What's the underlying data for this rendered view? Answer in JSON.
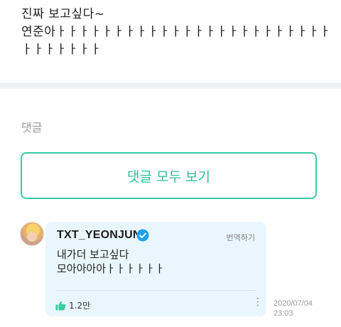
{
  "post": {
    "text": "진짜 보고싶다~\n연준아ㅏㅏㅏㅏㅏㅏㅏㅏㅏㅏㅏㅏㅏㅏㅏㅏㅏㅏㅏㅏㅏㅏㅏㅏㅏㅏㅏㅏㅏㅏㅏ"
  },
  "comments": {
    "section_label": "댓글",
    "view_all_label": "댓글 모두 보기"
  },
  "reply": {
    "author": "TXT_YEONJUN",
    "verified_icon": "verified-badge-icon",
    "translate_label": "번역하기",
    "text": "내가더 보고싶다\n모아아아아ㅏㅏㅏㅏㅏㅏ",
    "likes": "1.2만",
    "date": "2020/07/04",
    "time": "23:03",
    "more_icon": "more-vertical-icon"
  },
  "colors": {
    "accent": "#3bcba3",
    "bubble_bg": "#e9f6fd",
    "verified": "#1da1f2"
  }
}
